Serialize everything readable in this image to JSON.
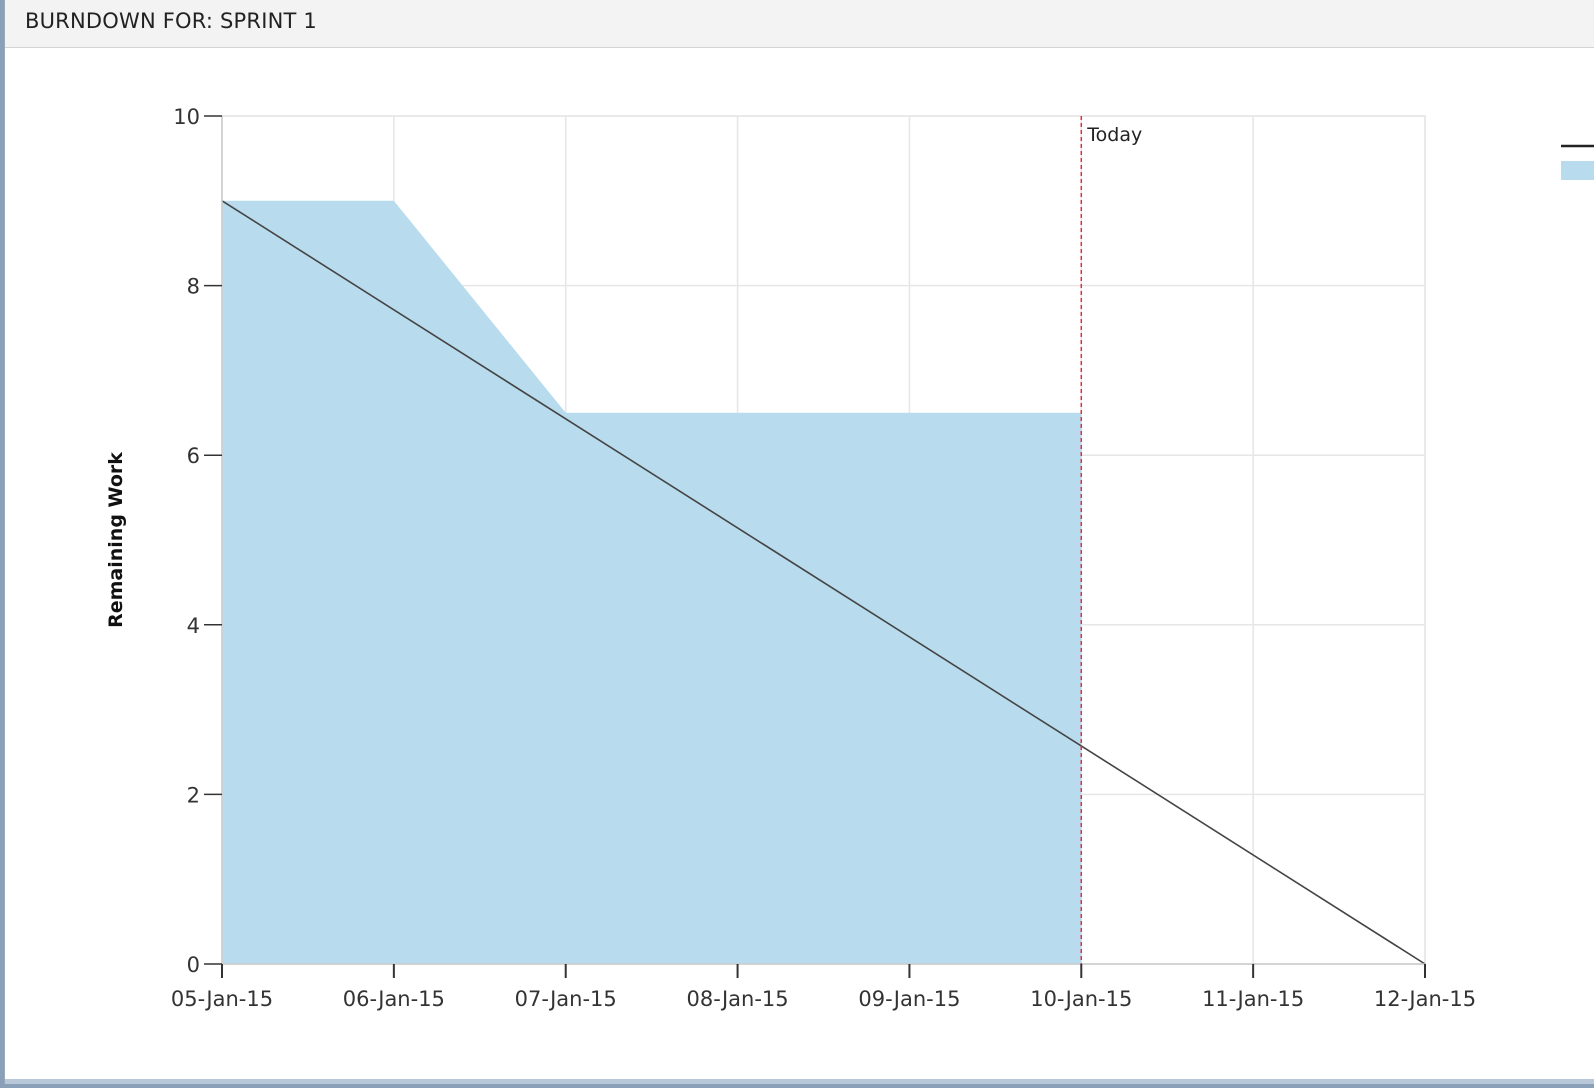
{
  "header": {
    "title": "BURNDOWN FOR: SPRINT 1"
  },
  "colors": {
    "remaining_fill": "#b8dcee",
    "ideal_line": "#444444",
    "today_line": "#e0303a",
    "grid": "#e6e6e6"
  },
  "chart_data": {
    "type": "area",
    "title": "",
    "xlabel": "",
    "ylabel": "Remaining Work",
    "x": [
      "05-Jan-15",
      "06-Jan-15",
      "07-Jan-15",
      "08-Jan-15",
      "09-Jan-15",
      "10-Jan-15",
      "11-Jan-15",
      "12-Jan-15"
    ],
    "ylim": [
      0,
      10
    ],
    "yticks": [
      0,
      2,
      4,
      6,
      8,
      10
    ],
    "grid": true,
    "series": [
      {
        "kind": "area",
        "x": [
          "05-Jan-15",
          "06-Jan-15",
          "07-Jan-15",
          "08-Jan-15",
          "09-Jan-15",
          "10-Jan-15"
        ],
        "values": [
          9,
          9,
          6.5,
          6.5,
          6.5,
          6.5
        ]
      },
      {
        "kind": "line",
        "x": [
          "05-Jan-15",
          "12-Jan-15"
        ],
        "values": [
          9,
          0
        ]
      }
    ],
    "annotations": [
      {
        "x": "10-Jan-15",
        "label": "Today"
      }
    ]
  }
}
